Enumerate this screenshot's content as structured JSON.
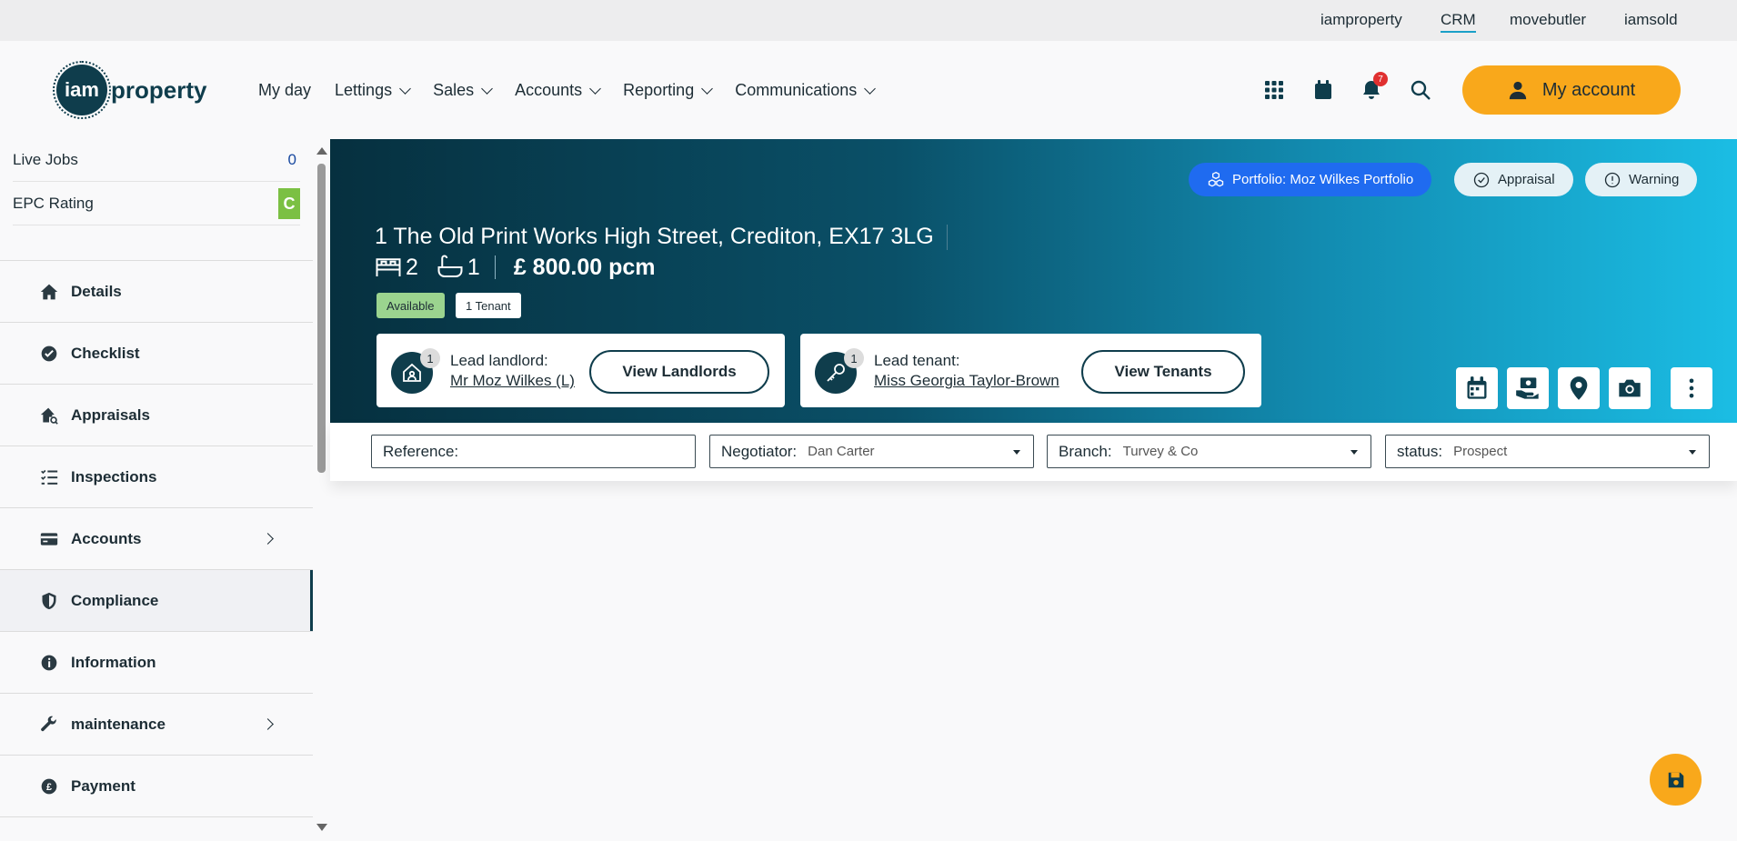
{
  "topbar": {
    "brands": [
      "iamproperty",
      "CRM",
      "movebutler",
      "iamsold"
    ],
    "active_brand": "CRM"
  },
  "header": {
    "logo_mark": "iam",
    "logo_word": "property",
    "nav": [
      "My day",
      "Lettings",
      "Sales",
      "Accounts",
      "Reporting",
      "Communications"
    ],
    "notification_count": "7",
    "account_label": "My account"
  },
  "sidebar": {
    "stats": [
      {
        "label": "Live Jobs",
        "value": "0"
      },
      {
        "label": "EPC Rating",
        "value": "C"
      }
    ],
    "items": [
      {
        "label": "Details",
        "icon": "home-icon"
      },
      {
        "label": "Checklist",
        "icon": "check-circle-icon"
      },
      {
        "label": "Appraisals",
        "icon": "house-search-icon"
      },
      {
        "label": "Inspections",
        "icon": "list-check-icon"
      },
      {
        "label": "Accounts",
        "icon": "credit-card-icon"
      },
      {
        "label": "Compliance",
        "icon": "shield-icon"
      },
      {
        "label": "Information",
        "icon": "info-icon"
      },
      {
        "label": "maintenance",
        "icon": "wrench-icon"
      },
      {
        "label": "Payment",
        "icon": "pound-icon"
      }
    ]
  },
  "banner": {
    "portfolio_label": "Portfolio: Moz Wilkes Portfolio",
    "appraisal_label": "Appraisal",
    "warning_label": "Warning",
    "address": "1 The Old Print Works High Street, Crediton, EX17 3LG",
    "bedrooms": "2",
    "bathrooms": "1",
    "price": "£ 800.00 pcm",
    "tags": [
      "Available",
      "1 Tenant"
    ],
    "landlord": {
      "count": "1",
      "label": "Lead landlord:",
      "name": "Mr Moz Wilkes (L)",
      "button": "View Landlords"
    },
    "tenant": {
      "count": "1",
      "label": "Lead tenant:",
      "name": "Miss Georgia Taylor-Brown",
      "button": "View Tenants"
    },
    "actions": [
      "calendar-icon",
      "hand-money-icon",
      "map-pin-icon",
      "camera-icon",
      "more-vertical-icon"
    ]
  },
  "filters": {
    "reference_label": "Reference:",
    "reference_value": "",
    "negotiator_label": "Negotiator:",
    "negotiator_value": "Dan Carter",
    "branch_label": "Branch:",
    "branch_value": "Turvey & Co",
    "status_label": "status:",
    "status_value": "Prospect"
  },
  "colors": {
    "accent": "#f9a81b",
    "brand_dark": "#0f3d4c",
    "portfolio_blue": "#1f6bf0"
  }
}
